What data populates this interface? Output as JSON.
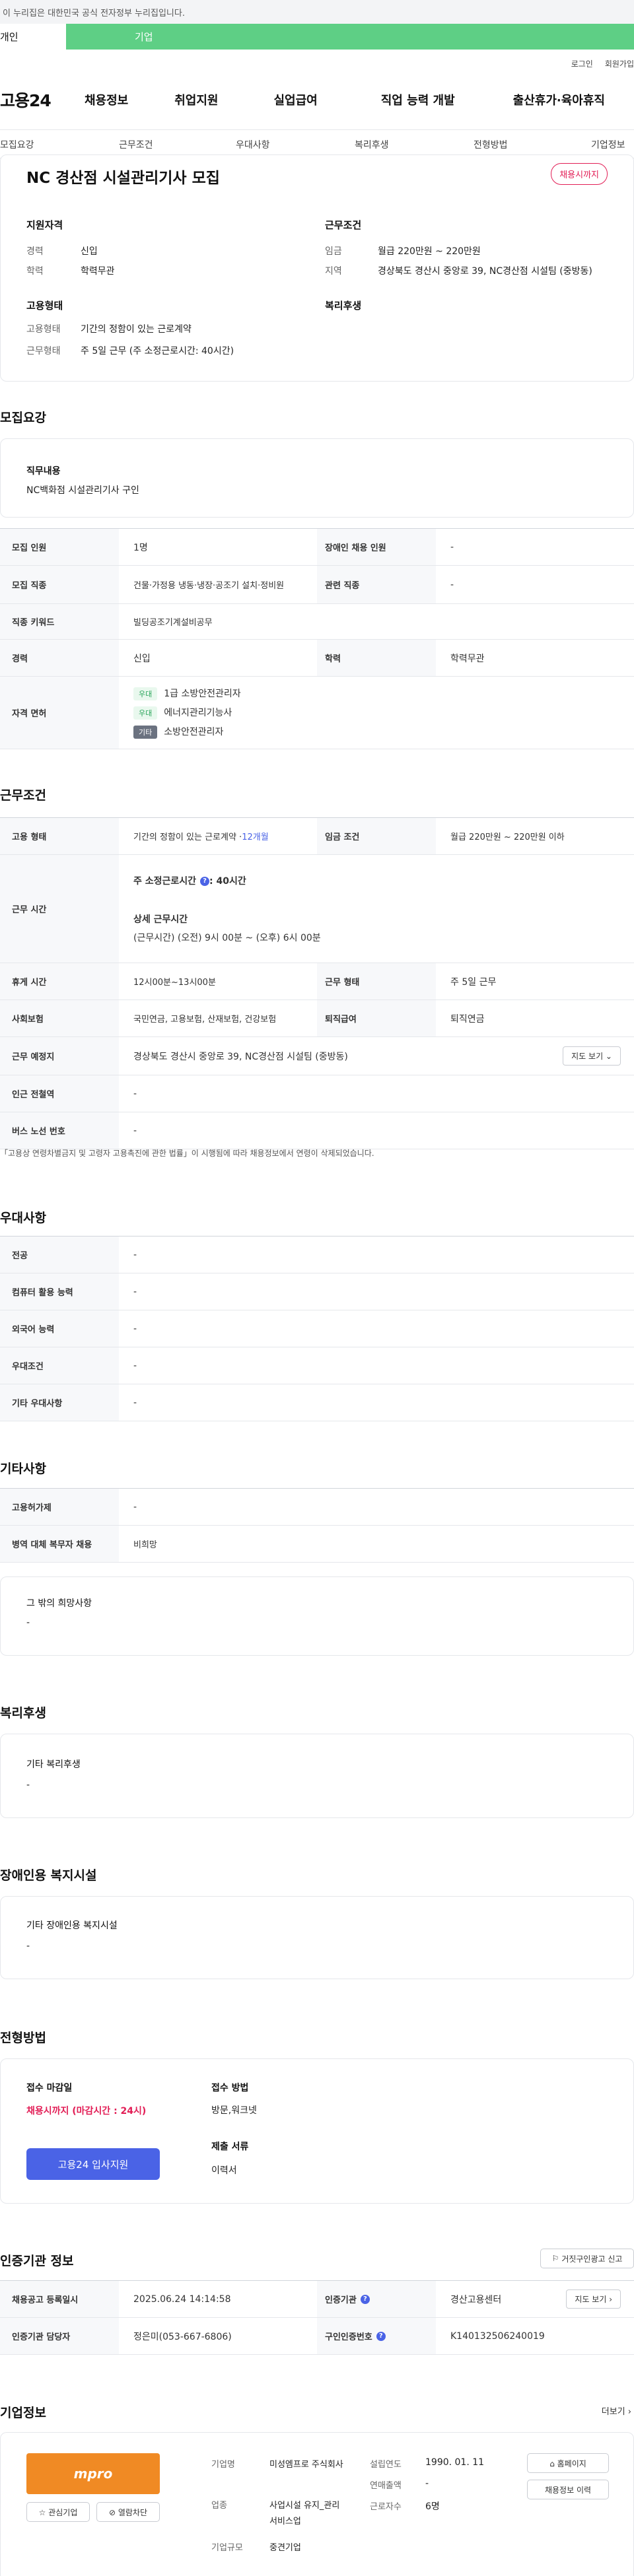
{
  "gov_banner": "이 누리집은 대한민국 공식 전자정부 누리집입니다.",
  "user_tabs": {
    "personal": "개인",
    "company": "기업"
  },
  "util": {
    "login": "로그인",
    "signup": "회원가입"
  },
  "logo": "고용24",
  "gnb": [
    "채용정보",
    "취업지원",
    "실업급여",
    "직업 능력 개발",
    "출산휴가·육아휴직"
  ],
  "subnav": [
    "모집요강",
    "근무조건",
    "우대사항",
    "복리후생",
    "전형방법",
    "기업정보"
  ],
  "summary": {
    "title": "NC 경산점 시설관리기사 모집",
    "deadline_badge": "채용시까지",
    "qualification_heading": "지원자격",
    "career_label": "경력",
    "career_value": "신입",
    "education_label": "학력",
    "education_value": "학력무관",
    "condition_heading": "근무조건",
    "wage_label": "임금",
    "wage_value": "월급 220만원 ~ 220만원",
    "location_label": "지역",
    "location_value": "경상북도 경산시 중앙로 39, NC경산점 시설팀 (중방동)",
    "employment_heading": "고용형태",
    "emp_type_label": "고용형태",
    "emp_type_value": "기간의 정함이 있는 근로계약",
    "work_type_label": "근무형태",
    "work_type_value": "주 5일 근무 (주 소정근로시간: 40시간)",
    "welfare_heading": "복리후생"
  },
  "recruit": {
    "section_title": "모집요강",
    "job_desc_heading": "직무내용",
    "job_desc_value": "NC백화점 시설관리기사 구인",
    "rows": {
      "headcount_label": "모집 인원",
      "headcount_value": "1명",
      "disabled_label": "장애인 채용 인원",
      "disabled_value": "-",
      "job_label": "모집 직종",
      "job_value": "건물·가정용 냉동·냉장·공조기 설치·정비원",
      "related_label": "관련 직종",
      "related_value": "-",
      "keyword_label": "직종 키워드",
      "keyword_value": "빌딩공조기계설비공무",
      "career_label": "경력",
      "career_value": "신입",
      "edu_label": "학력",
      "edu_value": "학력무관",
      "license_label": "자격 면허",
      "licenses": [
        {
          "tag": "우대",
          "name": "1급 소방안전관리자"
        },
        {
          "tag": "우대",
          "name": "에너지관리기능사"
        },
        {
          "tag": "기타",
          "name": "소방안전관리자"
        }
      ]
    }
  },
  "work": {
    "section_title": "근무조건",
    "emp_label": "고용 형태",
    "emp_value": "기간의 정함이 있는 근로계약 · ",
    "emp_months": "12개월",
    "wage_label": "임금 조건",
    "wage_value": "월급 220만원 ~ 220만원 이하",
    "hours_label": "근무 시간",
    "weekly_hours_label": "주 소정근로시간",
    "weekly_hours_value": ": 40시간",
    "detail_hours_label": "상세 근무시간",
    "detail_hours_value": "(근무시간) (오전) 9시 00분 ~ (오후) 6시 00분",
    "break_label": "휴게 시간",
    "break_value": "12시00분~13시00분",
    "worktype_label": "근무 형태",
    "worktype_value": "주 5일 근무",
    "insurance_label": "사회보험",
    "insurance_value": "국민연금, 고용보험, 산재보험, 건강보험",
    "severance_label": "퇴직급여",
    "severance_value": "퇴직연금",
    "place_label": "근무 예정지",
    "place_value": "경상북도 경산시 중앙로 39, NC경산점 시설팀 (중방동)",
    "map_button": "지도 보기 ⌄",
    "subway_label": "인근 전철역",
    "subway_value": "-",
    "bus_label": "버스 노선 번호",
    "bus_value": "-",
    "note": "「고용상 연령차별금지 및 고령자 고용촉진에 관한 법률」이 시행됨에 따라 채용정보에서 연령이 삭제되었습니다."
  },
  "pref": {
    "section_title": "우대사항",
    "rows": [
      {
        "label": "전공",
        "value": "-"
      },
      {
        "label": "컴퓨터 활용 능력",
        "value": "-"
      },
      {
        "label": "외국어 능력",
        "value": "-"
      },
      {
        "label": "우대조건",
        "value": "-"
      },
      {
        "label": "기타 우대사항",
        "value": "-"
      }
    ]
  },
  "etc": {
    "section_title": "기타사항",
    "rows": [
      {
        "label": "고용허가제",
        "value": "-"
      },
      {
        "label": "병역 대체 복무자 채용",
        "value": "비희망"
      }
    ],
    "other_heading": "그 밖의 희망사항",
    "other_value": "-"
  },
  "welfare": {
    "section_title": "복리후생",
    "heading": "기타 복리후생",
    "value": "-"
  },
  "disabled_facility": {
    "section_title": "장애인용 복지시설",
    "heading": "기타 장애인용 복지시설",
    "value": "-"
  },
  "screening": {
    "section_title": "전형방법",
    "deadline_heading": "접수 마감일",
    "deadline_value": "채용시까지 (마감시간 : 24시)",
    "method_heading": "접수 방법",
    "method_value": "방문,워크넷",
    "docs_heading": "제출 서류",
    "docs_value": "이력서",
    "apply_button": "고용24 입사지원"
  },
  "cert": {
    "section_title": "인증기관 정보",
    "report_button": "거짓구인광고 신고",
    "reg_label": "채용공고 등록일시",
    "reg_value": "2025.06.24 14:14:58",
    "agency_label": "인증기관",
    "agency_value": "경산고용센터",
    "agency_map": "지도 보기 ›",
    "manager_label": "인증기관 담당자",
    "manager_value": "정은미(053-667-6806)",
    "number_label": "구인인증번호",
    "number_value": "K140132506240019"
  },
  "company": {
    "section_title": "기업정보",
    "more": "더보기 ›",
    "logo_text": "mpro",
    "interest_button": "☆ 관심기업",
    "block_button": "⊘ 열람차단",
    "name_label": "기업명",
    "name_value": "미성엠프로 주식회사",
    "biz_label": "업종",
    "biz_value": "사업시설 유지_관리 서비스업",
    "size_label": "기업규모",
    "size_value": "중견기업",
    "founded_label": "설립연도",
    "founded_value": "1990. 01. 11",
    "revenue_label": "연매출액",
    "revenue_value": "-",
    "employees_label": "근로자수",
    "employees_value": "6명",
    "homepage_button": "⌂ 홈페이지",
    "history_button": "채용정보 이력"
  }
}
